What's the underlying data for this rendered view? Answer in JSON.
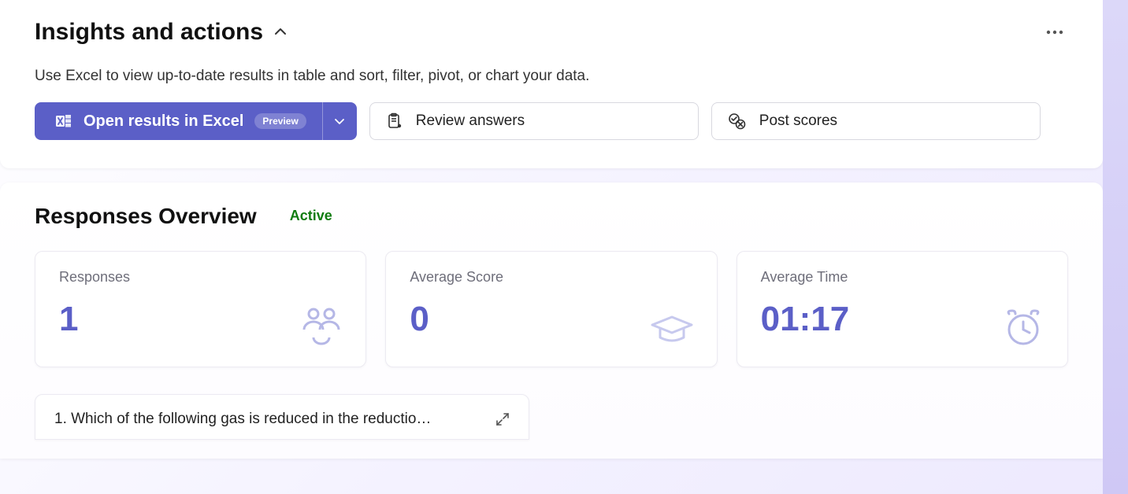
{
  "insights": {
    "title": "Insights and actions",
    "description": "Use Excel to view up-to-date results in table and sort, filter, pivot, or chart your data.",
    "open_excel_label": "Open results in Excel",
    "preview_badge": "Preview",
    "review_answers_label": "Review answers",
    "post_scores_label": "Post scores"
  },
  "overview": {
    "title": "Responses Overview",
    "status": "Active",
    "stats": {
      "responses_label": "Responses",
      "responses_value": "1",
      "avg_score_label": "Average Score",
      "avg_score_value": "0",
      "avg_time_label": "Average Time",
      "avg_time_value": "01:17"
    },
    "question": {
      "text": "1. Which of the following gas is reduced in the reductio…"
    }
  }
}
